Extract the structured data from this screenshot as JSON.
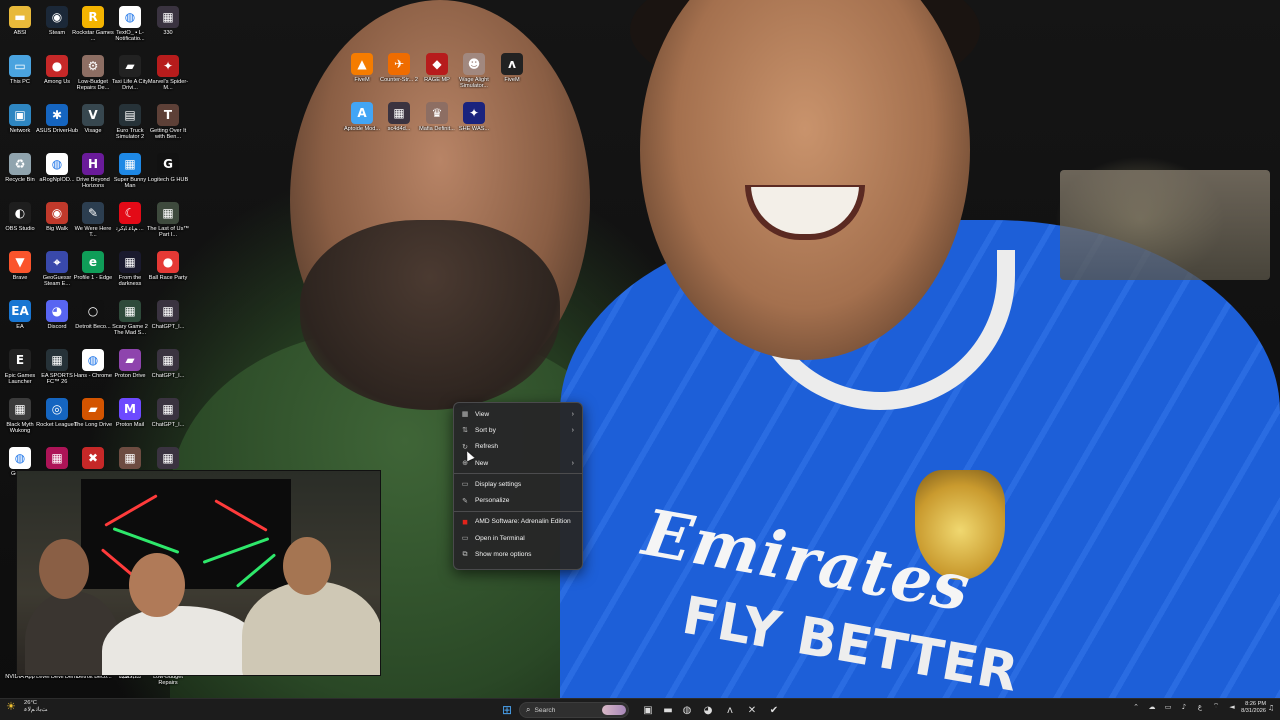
{
  "desktop": {
    "icons": [
      {
        "label": "ABSI",
        "icon": "folder-icon",
        "color": "#e8b93a",
        "glyph": "▬"
      },
      {
        "label": "Steam",
        "icon": "steam-icon",
        "color": "#1b2838",
        "glyph": "◉"
      },
      {
        "label": "Rockstar Games ...",
        "icon": "rockstar-icon",
        "color": "#f4b400",
        "glyph": "R"
      },
      {
        "label": "TextO_ ▪ L- Notificatio...",
        "icon": "chrome-icon",
        "color": "#ffffff",
        "glyph": "◍"
      },
      {
        "label": "330",
        "icon": "game-thumbnail-icon",
        "color": "#3a3340",
        "glyph": "▦"
      },
      {
        "label": "This PC",
        "icon": "this-pc-icon",
        "color": "#4aa3df",
        "glyph": "▭"
      },
      {
        "label": "Among Us",
        "icon": "among-us-icon",
        "color": "#c62828",
        "glyph": "●"
      },
      {
        "label": "Low-Budget Repairs De...",
        "icon": "game-icon",
        "color": "#8d6e63",
        "glyph": "⚙"
      },
      {
        "label": "Taxi Life A City Drivi...",
        "icon": "taxi-icon",
        "color": "#222222",
        "glyph": "▰"
      },
      {
        "label": "Marvel's Spider-M...",
        "icon": "spiderman-icon",
        "color": "#b71c1c",
        "glyph": "✦"
      },
      {
        "label": "Network",
        "icon": "network-icon",
        "color": "#2e86c1",
        "glyph": "▣"
      },
      {
        "label": "ASUS DriverHub",
        "icon": "asus-icon",
        "color": "#1565c0",
        "glyph": "✱"
      },
      {
        "label": "Visage",
        "icon": "visage-icon",
        "color": "#37474f",
        "glyph": "V"
      },
      {
        "label": "Euro Truck Simulator 2",
        "icon": "truck-icon",
        "color": "#263238",
        "glyph": "▤"
      },
      {
        "label": "Getting Over It with Ben...",
        "icon": "game-icon",
        "color": "#5d4037",
        "glyph": "T"
      },
      {
        "label": "Recycle Bin",
        "icon": "recycle-bin-icon",
        "color": "#90a4ae",
        "glyph": "♻"
      },
      {
        "label": "aRogNpIOD...",
        "icon": "chrome-icon",
        "color": "#ffffff",
        "glyph": "◍"
      },
      {
        "label": "Drive Beyond Horizons",
        "icon": "game-icon",
        "color": "#6a1b9a",
        "glyph": "H"
      },
      {
        "label": "Super Bunny Man",
        "icon": "game-icon",
        "color": "#1e88e5",
        "glyph": "▦"
      },
      {
        "label": "Logitech G HUB",
        "icon": "logitech-icon",
        "color": "#111111",
        "glyph": "G"
      },
      {
        "label": "OBS Studio",
        "icon": "obs-icon",
        "color": "#1e1e1e",
        "glyph": "◐"
      },
      {
        "label": "Big Walk",
        "icon": "game-icon",
        "color": "#c0392b",
        "glyph": "◉"
      },
      {
        "label": "We Were Here T...",
        "icon": "game-icon",
        "color": "#2c3e50",
        "glyph": "✎"
      },
      {
        "label": "ﻢﻠﻋ ﺎﻴﻛﺮﺗ ...",
        "icon": "turkey-flag-icon",
        "color": "#e30a17",
        "glyph": "☾"
      },
      {
        "label": "The Last of Us™ Part I...",
        "icon": "game-icon",
        "color": "#3e4a3d",
        "glyph": "▦"
      },
      {
        "label": "Brave",
        "icon": "brave-icon",
        "color": "#fb542b",
        "glyph": "▼"
      },
      {
        "label": "GeoGuessr Steam E...",
        "icon": "geoguessr-icon",
        "color": "#3949ab",
        "glyph": "⌖"
      },
      {
        "label": "Profile 1 - Edge",
        "icon": "edge-icon",
        "color": "#0f9d58",
        "glyph": "e"
      },
      {
        "label": "From the darkness",
        "icon": "game-icon",
        "color": "#1a1a2e",
        "glyph": "▦"
      },
      {
        "label": "Ball Race Party",
        "icon": "game-icon",
        "color": "#e53935",
        "glyph": "●"
      },
      {
        "label": "EA",
        "icon": "ea-icon",
        "color": "#1976d2",
        "glyph": "EA"
      },
      {
        "label": "Discord",
        "icon": "discord-icon",
        "color": "#5865f2",
        "glyph": "◕"
      },
      {
        "label": "Detroit Beco...",
        "icon": "game-icon",
        "color": "#111111",
        "glyph": "○"
      },
      {
        "label": "Scary Game 2 The Mad S...",
        "icon": "game-icon",
        "color": "#2e4a3a",
        "glyph": "▦"
      },
      {
        "label": "ChatGPT_I...",
        "icon": "game-thumbnail-icon",
        "color": "#3a3340",
        "glyph": "▦"
      },
      {
        "label": "Epic Games Launcher",
        "icon": "epic-games-icon",
        "color": "#222222",
        "glyph": "E"
      },
      {
        "label": "EA SPORTS FC™ 26",
        "icon": "game-icon",
        "color": "#263238",
        "glyph": "▦"
      },
      {
        "label": "Hans - Chrome",
        "icon": "chrome-icon",
        "color": "#ffffff",
        "glyph": "◍"
      },
      {
        "label": "Proton Drive",
        "icon": "proton-drive-icon",
        "color": "#8e44ad",
        "glyph": "▰"
      },
      {
        "label": "ChatGPT_I...",
        "icon": "game-thumbnail-icon",
        "color": "#3a3340",
        "glyph": "▦"
      },
      {
        "label": "Black Myth Wukong",
        "icon": "game-icon",
        "color": "#3b3b3b",
        "glyph": "▦"
      },
      {
        "label": "Rocket League®",
        "icon": "rocket-league-icon",
        "color": "#1565c0",
        "glyph": "◎"
      },
      {
        "label": "The Long Drive",
        "icon": "game-icon",
        "color": "#d35400",
        "glyph": "▰"
      },
      {
        "label": "Proton Mail",
        "icon": "proton-mail-icon",
        "color": "#6d4aff",
        "glyph": "M"
      },
      {
        "label": "ChatGPT_I...",
        "icon": "game-thumbnail-icon",
        "color": "#3a3340",
        "glyph": "▦"
      },
      {
        "label": "Go Chr",
        "icon": "chrome-icon",
        "color": "#ffffff",
        "glyph": "◍"
      },
      {
        "label": "",
        "icon": "game-icon",
        "color": "#ad1457",
        "glyph": "▦"
      },
      {
        "label": "",
        "icon": "game-icon",
        "color": "#c62828",
        "glyph": "✖"
      },
      {
        "label": "",
        "icon": "game-icon",
        "color": "#6d4c41",
        "glyph": "▦"
      },
      {
        "label": "",
        "icon": "game-thumbnail-icon",
        "color": "#3a3340",
        "glyph": "▦"
      }
    ],
    "bottom_icons": [
      {
        "label": "NVIDIA App",
        "icon": "nvidia-icon",
        "color": "#76b900",
        "glyph": "◣"
      },
      {
        "label": "Level Devil Demo",
        "icon": "game-icon",
        "color": "#333333",
        "glyph": "▦"
      },
      {
        "label": "Detroit Beco...",
        "icon": "game-icon",
        "color": "#111111",
        "glyph": "○"
      },
      {
        "label": "ﺕﺎﺒﻟﺎﻄﻤﻟﺍ",
        "icon": "game-icon",
        "color": "#444444",
        "glyph": "▦"
      },
      {
        "label": "Low-Budget Repairs",
        "icon": "game-icon",
        "color": "#8d6e63",
        "glyph": "⚙"
      }
    ],
    "center_icons": [
      {
        "label": "FiveM",
        "icon": "fivem-icon",
        "color": "#f57c00",
        "glyph": "▲"
      },
      {
        "label": "Counter-Str... 2",
        "icon": "counter-strike-icon",
        "color": "#ef6c00",
        "glyph": "✈"
      },
      {
        "label": "RAGE MP",
        "icon": "rage-mp-icon",
        "color": "#b71c1c",
        "glyph": "◆"
      },
      {
        "label": "Wage Alight Simulator...",
        "icon": "game-icon",
        "color": "#a1887f",
        "glyph": "☻"
      },
      {
        "label": "FiveM",
        "icon": "fivem-icon",
        "color": "#222222",
        "glyph": "ʌ"
      },
      {
        "label": "Aptoide Mod...",
        "icon": "aptoide-icon",
        "color": "#42a5f5",
        "glyph": "A"
      },
      {
        "label": "sc4d4d...",
        "icon": "game-thumbnail-icon",
        "color": "#3a3340",
        "glyph": "▦"
      },
      {
        "label": "Mafia Definit...",
        "icon": "mafia-icon",
        "color": "#8d6e63",
        "glyph": "♛"
      },
      {
        "label": "SHE WAS...",
        "icon": "game-icon",
        "color": "#1a237e",
        "glyph": "✦"
      }
    ]
  },
  "context_menu": {
    "items": [
      {
        "label": "View",
        "icon": "grid-icon",
        "glyph": "▦",
        "submenu": true
      },
      {
        "label": "Sort by",
        "icon": "sort-icon",
        "glyph": "⇅",
        "submenu": true
      },
      {
        "label": "Refresh",
        "icon": "refresh-icon",
        "glyph": "↻",
        "submenu": false
      },
      {
        "label": "New",
        "icon": "new-icon",
        "glyph": "⊕",
        "submenu": true
      },
      {
        "label": "Display settings",
        "icon": "display-icon",
        "glyph": "▭",
        "submenu": false
      },
      {
        "label": "Personalize",
        "icon": "brush-icon",
        "glyph": "✎",
        "submenu": false
      },
      {
        "label": "AMD Software: Adrenalin Edition",
        "icon": "amd-icon",
        "glyph": "◼",
        "submenu": false
      },
      {
        "label": "Open in Terminal",
        "icon": "terminal-icon",
        "glyph": "▭",
        "submenu": false
      },
      {
        "label": "Show more options",
        "icon": "more-options-icon",
        "glyph": "⧉",
        "submenu": false
      }
    ],
    "submenu_arrow": "›",
    "amd_color": "#e2231a"
  },
  "wallpaper": {
    "sponsor_line1": "Emirates",
    "sponsor_line2": "FLY BETTER"
  },
  "taskbar": {
    "weather_temp": "26°C",
    "weather_desc": "ﺖﺑﺎﺛ ﻢﻟﺎﻋ",
    "search_label": "Search",
    "start_glyph": "⊞",
    "pinned": [
      {
        "name": "task-view-icon",
        "glyph": "▣"
      },
      {
        "name": "file-explorer-icon",
        "glyph": "▬"
      },
      {
        "name": "chrome-icon",
        "glyph": "◍"
      },
      {
        "name": "discord-icon",
        "glyph": "◕"
      },
      {
        "name": "fivem-icon",
        "glyph": "ʌ"
      },
      {
        "name": "xbox-icon",
        "glyph": "✕"
      },
      {
        "name": "app-icon",
        "glyph": "✔"
      }
    ],
    "tray": [
      {
        "name": "chevron-up-icon",
        "glyph": "⌃"
      },
      {
        "name": "cloud-icon",
        "glyph": "☁"
      },
      {
        "name": "onedrive-icon",
        "glyph": "▭"
      },
      {
        "name": "microphone-icon",
        "glyph": "♪"
      },
      {
        "name": "language-indicator",
        "glyph": "ع"
      },
      {
        "name": "wifi-icon",
        "glyph": "⌔"
      },
      {
        "name": "volume-icon",
        "glyph": "◄"
      }
    ],
    "time": "8:26 PM",
    "date": "8/31/2026",
    "bell_glyph": "♫"
  }
}
